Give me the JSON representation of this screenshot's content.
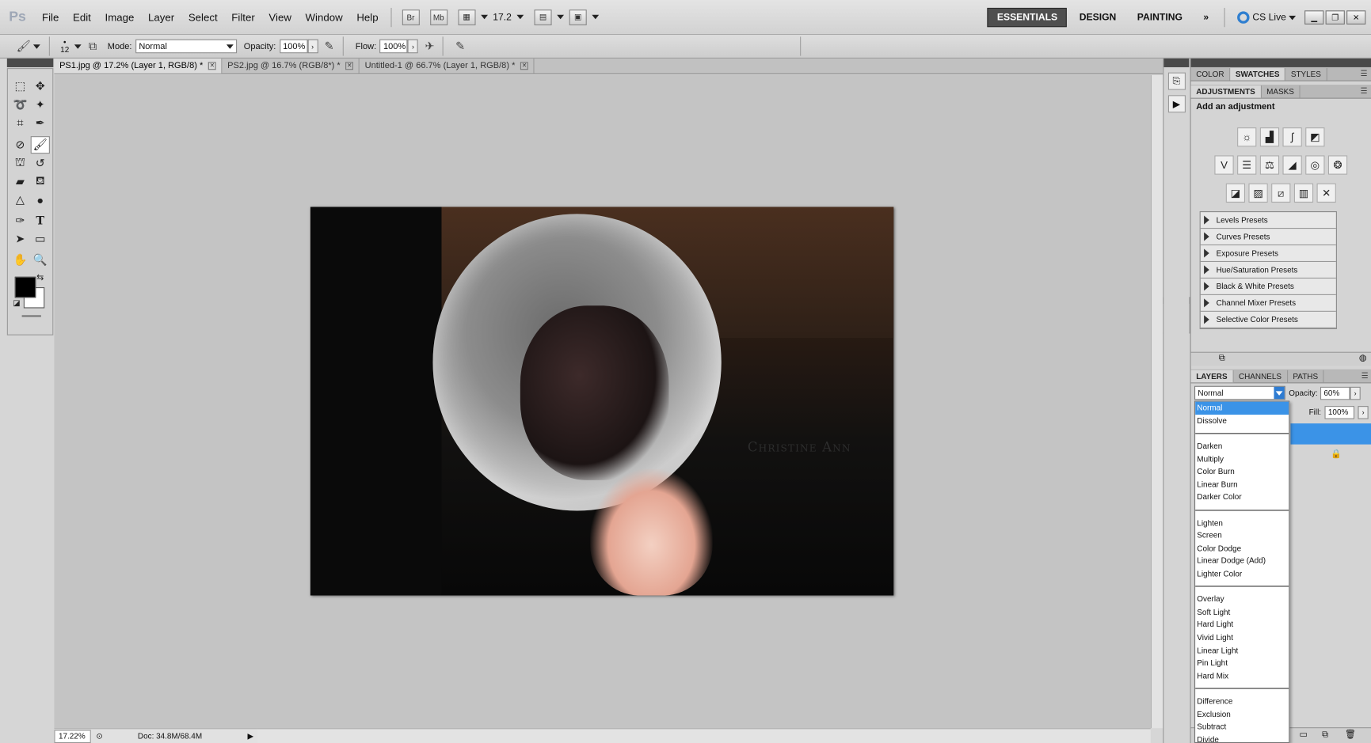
{
  "app": {
    "logo": "Ps"
  },
  "menu": [
    "File",
    "Edit",
    "Image",
    "Layer",
    "Select",
    "Filter",
    "View",
    "Window",
    "Help"
  ],
  "menubar_icons": {
    "bridge": "Br",
    "minibridge": "Mb",
    "zoom": "17.2"
  },
  "workspaces": [
    "ESSENTIALS",
    "DESIGN",
    "PAINTING"
  ],
  "workspace_more": "»",
  "cs_live": "CS Live",
  "options": {
    "brush_size": "12",
    "mode_label": "Mode:",
    "mode_value": "Normal",
    "opacity_label": "Opacity:",
    "opacity_value": "100%",
    "flow_label": "Flow:",
    "flow_value": "100%"
  },
  "tabs": [
    {
      "label": "PS1.jpg @ 17.2% (Layer 1, RGB/8) *"
    },
    {
      "label": "PS2.jpg @ 16.7% (RGB/8*) *"
    },
    {
      "label": "Untitled-1 @ 66.7% (Layer 1, RGB/8) *"
    }
  ],
  "status": {
    "zoom": "17.22%",
    "doc": "Doc: 34.8M/68.4M"
  },
  "photo": {
    "watermark": "Christine Ann"
  },
  "panels": {
    "top_tabs": [
      "COLOR",
      "SWATCHES",
      "STYLES"
    ],
    "adj_tabs": [
      "ADJUSTMENTS",
      "MASKS"
    ],
    "adj_title": "Add an adjustment",
    "presets": [
      "Levels Presets",
      "Curves Presets",
      "Exposure Presets",
      "Hue/Saturation Presets",
      "Black & White Presets",
      "Channel Mixer Presets",
      "Selective Color Presets"
    ],
    "layer_tabs": [
      "LAYERS",
      "CHANNELS",
      "PATHS"
    ],
    "blend_mode": "Normal",
    "opacity_label": "Opacity:",
    "opacity_value": "60%",
    "fill_label": "Fill:",
    "fill_value": "100%"
  },
  "blend_modes": [
    {
      "label": "Normal",
      "selected": true
    },
    {
      "label": "Dissolve"
    },
    {
      "sep": true
    },
    {
      "label": "Darken"
    },
    {
      "label": "Multiply"
    },
    {
      "label": "Color Burn"
    },
    {
      "label": "Linear Burn"
    },
    {
      "label": "Darker Color"
    },
    {
      "sep": true
    },
    {
      "label": "Lighten"
    },
    {
      "label": "Screen"
    },
    {
      "label": "Color Dodge"
    },
    {
      "label": "Linear Dodge (Add)"
    },
    {
      "label": "Lighter Color"
    },
    {
      "sep": true
    },
    {
      "label": "Overlay"
    },
    {
      "label": "Soft Light"
    },
    {
      "label": "Hard Light"
    },
    {
      "label": "Vivid Light"
    },
    {
      "label": "Linear Light"
    },
    {
      "label": "Pin Light"
    },
    {
      "label": "Hard Mix"
    },
    {
      "sep": true
    },
    {
      "label": "Difference"
    },
    {
      "label": "Exclusion"
    },
    {
      "label": "Subtract"
    },
    {
      "label": "Divide"
    }
  ],
  "colors": {
    "accent": "#3b93e7",
    "foreground": "#000000",
    "background": "#ffffff"
  }
}
